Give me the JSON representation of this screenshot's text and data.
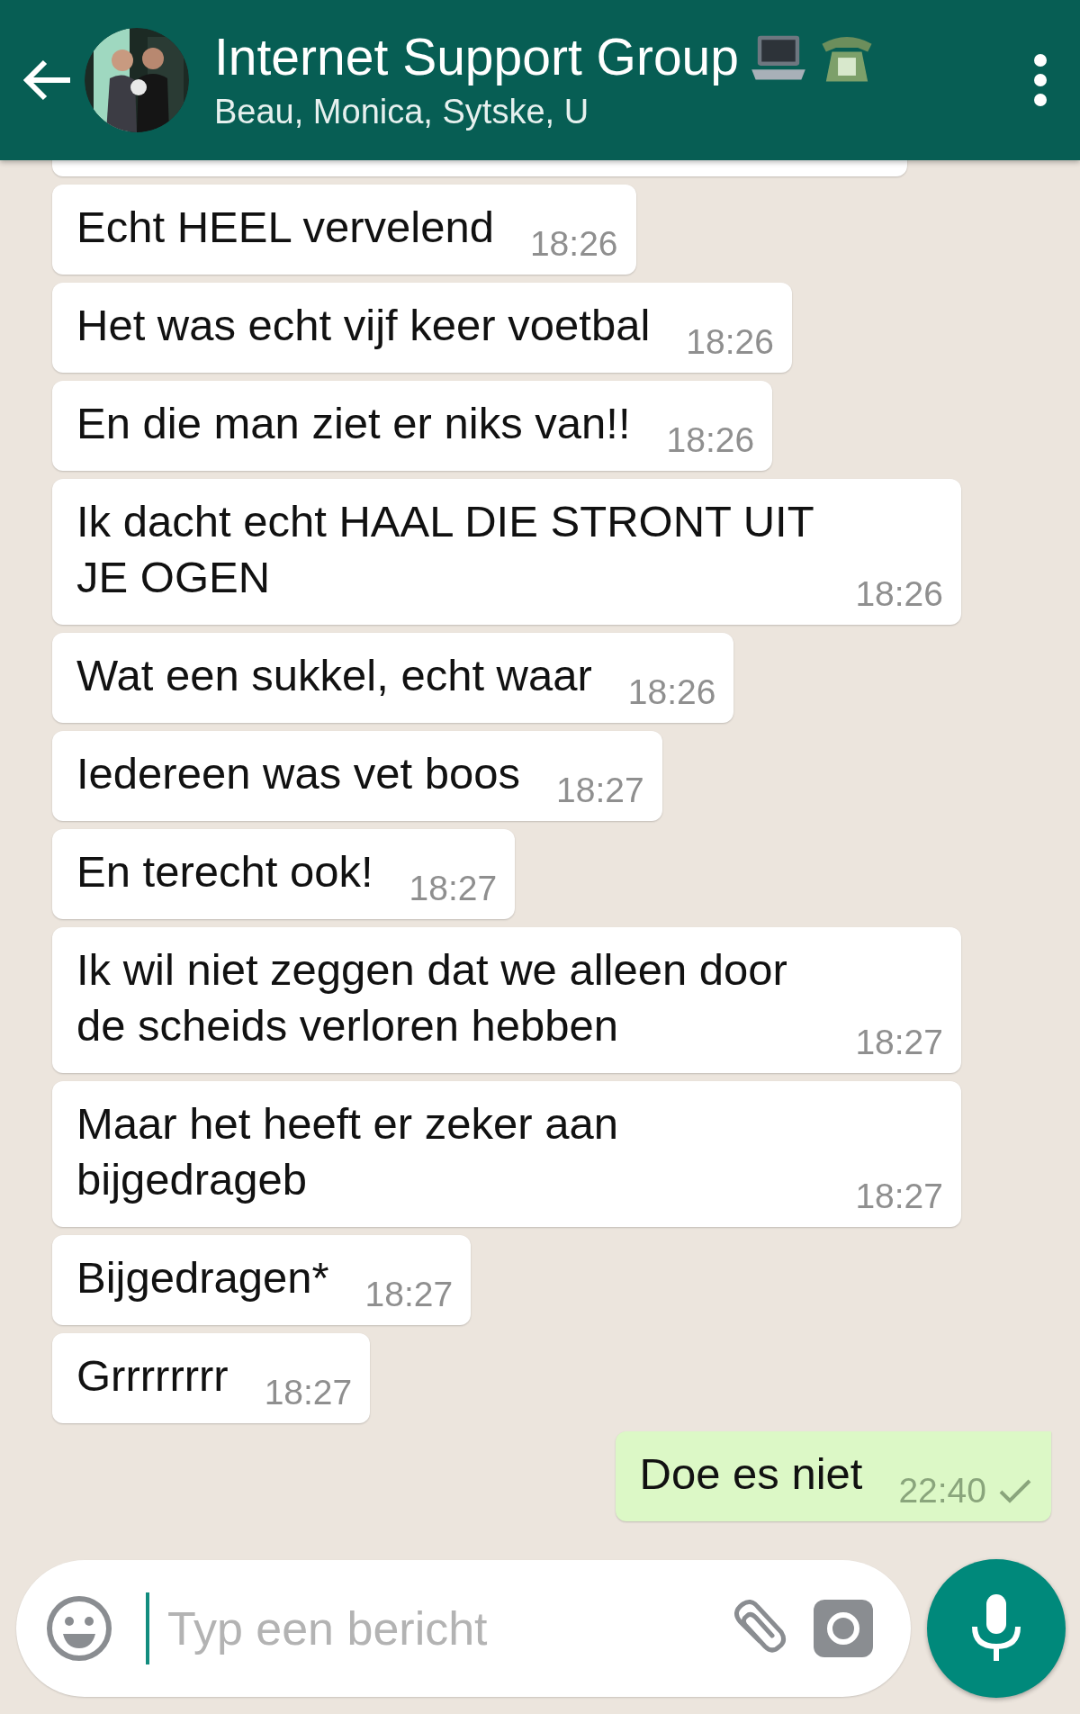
{
  "header": {
    "title": "Internet Support Group",
    "subtitle": "Beau, Monica, Sytske, U"
  },
  "messages": [
    {
      "kind": "cut",
      "outgoing": false
    },
    {
      "kind": "text",
      "outgoing": false,
      "text": "Echt HEEL vervelend",
      "time": "18:26"
    },
    {
      "kind": "text",
      "outgoing": false,
      "text": "Het was echt vijf keer voetbal",
      "time": "18:26"
    },
    {
      "kind": "text",
      "outgoing": false,
      "text": "En die man ziet er niks van!!",
      "time": "18:26"
    },
    {
      "kind": "text",
      "outgoing": false,
      "text": "Ik dacht echt HAAL DIE STRONT UIT JE OGEN",
      "time": "18:26"
    },
    {
      "kind": "text",
      "outgoing": false,
      "text": "Wat een sukkel, echt waar",
      "time": "18:26"
    },
    {
      "kind": "text",
      "outgoing": false,
      "text": "Iedereen was vet boos",
      "time": "18:27"
    },
    {
      "kind": "text",
      "outgoing": false,
      "text": "En terecht ook!",
      "time": "18:27"
    },
    {
      "kind": "text",
      "outgoing": false,
      "text": "Ik wil niet zeggen dat we alleen door de scheids verloren hebben",
      "time": "18:27"
    },
    {
      "kind": "text",
      "outgoing": false,
      "text": "Maar het heeft er zeker aan bijgedrageb",
      "time": "18:27"
    },
    {
      "kind": "text",
      "outgoing": false,
      "text": "Bijgedragen*",
      "time": "18:27"
    },
    {
      "kind": "text",
      "outgoing": false,
      "text": "Grrrrrrrr",
      "time": "18:27"
    },
    {
      "kind": "text",
      "outgoing": true,
      "text": "Doe es niet",
      "time": "22:40",
      "delivered": false
    }
  ],
  "composer": {
    "placeholder": "Typ een bericht"
  }
}
